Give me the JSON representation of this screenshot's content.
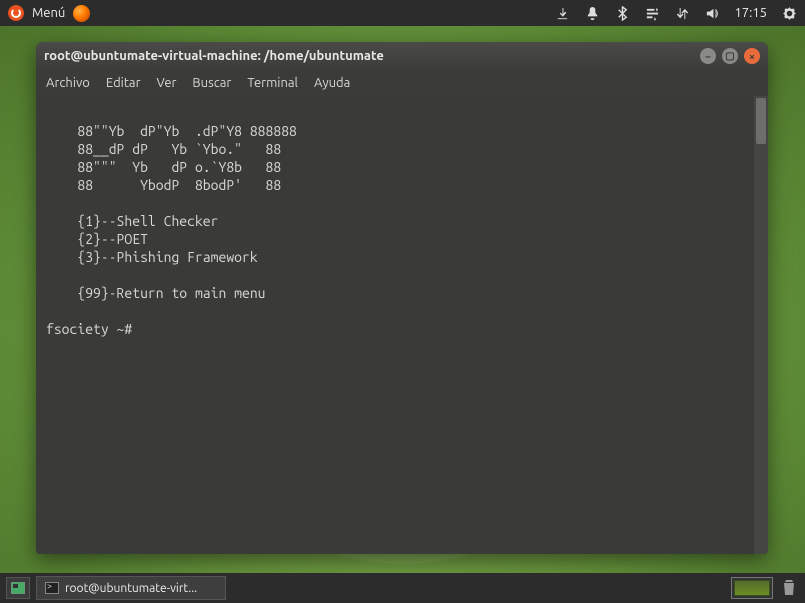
{
  "top_panel": {
    "menu_label": "Menú",
    "time": "17:15"
  },
  "window": {
    "title": "root@ubuntumate-virtual-machine: /home/ubuntumate",
    "menu": {
      "archivo": "Archivo",
      "editar": "Editar",
      "ver": "Ver",
      "buscar": "Buscar",
      "terminal": "Terminal",
      "ayuda": "Ayuda"
    },
    "content": "\n    88\"\"Yb  dP\"Yb  .dP\"Y8 888888\n    88__dP dP   Yb `Ybo.\"   88\n    88\"\"\"  Yb   dP o.`Y8b   88\n    88      YbodP  8bodP'   88\n\n    {1}--Shell Checker\n    {2}--POET\n    {3}--Phishing Framework\n\n    {99}-Return to main menu\n\nfsociety ~# "
  },
  "taskbar": {
    "task_label": "root@ubuntumate-virt..."
  }
}
